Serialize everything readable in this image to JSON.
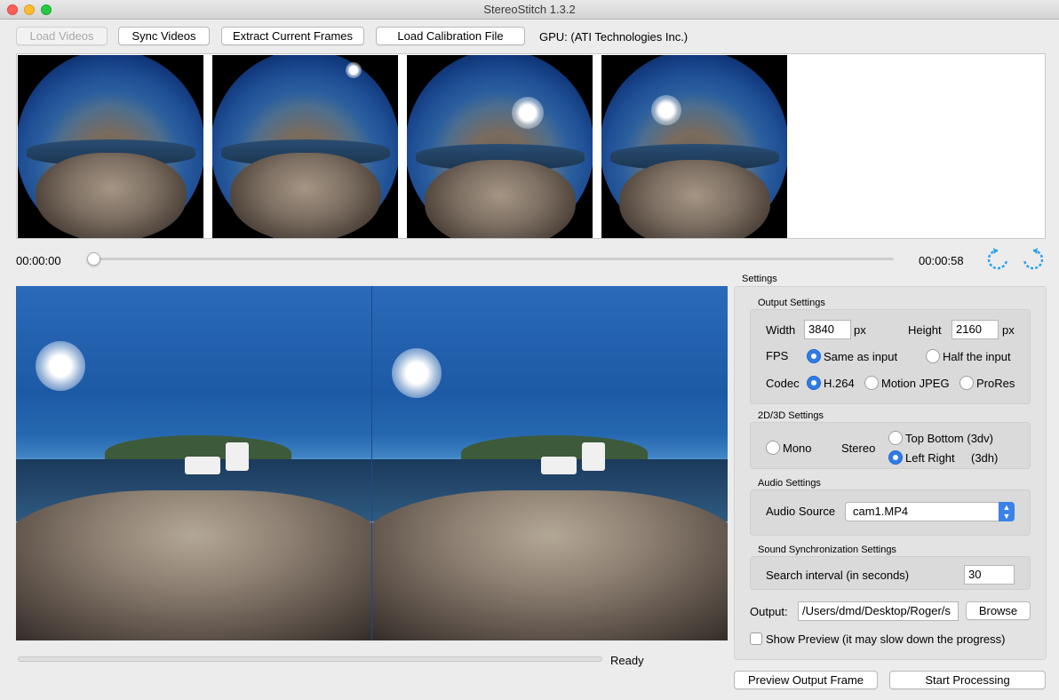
{
  "window": {
    "title": "StereoStitch 1.3.2"
  },
  "toolbar": {
    "load_videos": "Load Videos",
    "sync_videos": "Sync Videos",
    "extract_frames": "Extract Current Frames",
    "load_calibration": "Load Calibration File",
    "gpu_label": "GPU: (ATI Technologies Inc.)"
  },
  "timeline": {
    "start_time": "00:00:00",
    "end_time": "00:00:58",
    "position": 0.0
  },
  "thumbnails": [
    "cam1",
    "cam2",
    "cam3",
    "cam4"
  ],
  "status": {
    "text": "Ready",
    "progress": 0.0
  },
  "settings": {
    "title": "Settings",
    "output": {
      "title": "Output Settings",
      "width_label": "Width",
      "width_value": "3840",
      "width_unit": "px",
      "height_label": "Height",
      "height_value": "2160",
      "height_unit": "px",
      "fps_label": "FPS",
      "fps_same": "Same as input",
      "fps_half": "Half the input",
      "codec_label": "Codec",
      "codec_h264": "H.264",
      "codec_mjpeg": "Motion JPEG",
      "codec_prores": "ProRes"
    },
    "stereo": {
      "title": "2D/3D Settings",
      "mono": "Mono",
      "stereo_label": "Stereo",
      "top_bottom": "Top Bottom (3dv)",
      "left_right": "Left Right",
      "left_right_suffix": "(3dh)"
    },
    "audio": {
      "title": "Audio Settings",
      "source_label": "Audio Source",
      "source_value": "cam1.MP4"
    },
    "sound_sync": {
      "title": "Sound Synchronization Settings",
      "interval_label": "Search interval (in seconds)",
      "interval_value": "30"
    },
    "output_path": {
      "label": "Output:",
      "value": "/Users/dmd/Desktop/Roger/s",
      "browse": "Browse"
    },
    "show_preview": "Show Preview (it may slow down the progress)"
  },
  "actions": {
    "preview_frame": "Preview Output Frame",
    "start": "Start Processing"
  },
  "colors": {
    "accent": "#2f7ce6",
    "icon_blue": "#2a9ff0"
  }
}
